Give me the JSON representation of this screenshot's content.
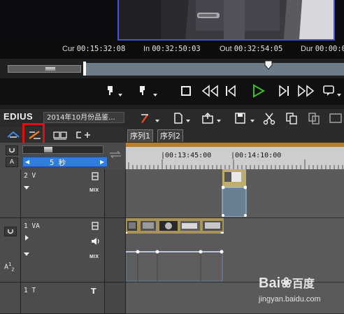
{
  "player": {
    "timecodes": {
      "cur_label": "Cur",
      "cur_value": "00:15:32:08",
      "in_label": "In",
      "in_value": "00:32:50:03",
      "out_label": "Out",
      "out_value": "00:32:54:05",
      "dur_label": "Dur",
      "dur_value": "00:00:0"
    }
  },
  "timeline": {
    "app_name": "EDIUS",
    "project_name": "2014年10月份品鉴...",
    "tabs": [
      "序列1",
      "序列2"
    ],
    "zoom_value": "5 秒",
    "ruler_ticks": [
      "|00:13:45:00",
      "|00:14:10:00"
    ],
    "tracks": [
      {
        "label": "2 V",
        "mix": "MIX"
      },
      {
        "label": "1 VA",
        "mix": "MIX"
      },
      {
        "label": "1 T"
      }
    ],
    "audio_label_a": "A",
    "audio_sub": "1",
    "audio_sub2": "2"
  },
  "watermark": {
    "brand": "Bai",
    "brand2": "百度",
    "site": "jingyan.baidu.com"
  },
  "colors": {
    "accent_blue": "#3a58d8",
    "highlight_red": "#e01010",
    "play_green": "#3fbf2a",
    "zoom_blue": "#2f7de3",
    "ruler_orange": "#b87d2b"
  }
}
